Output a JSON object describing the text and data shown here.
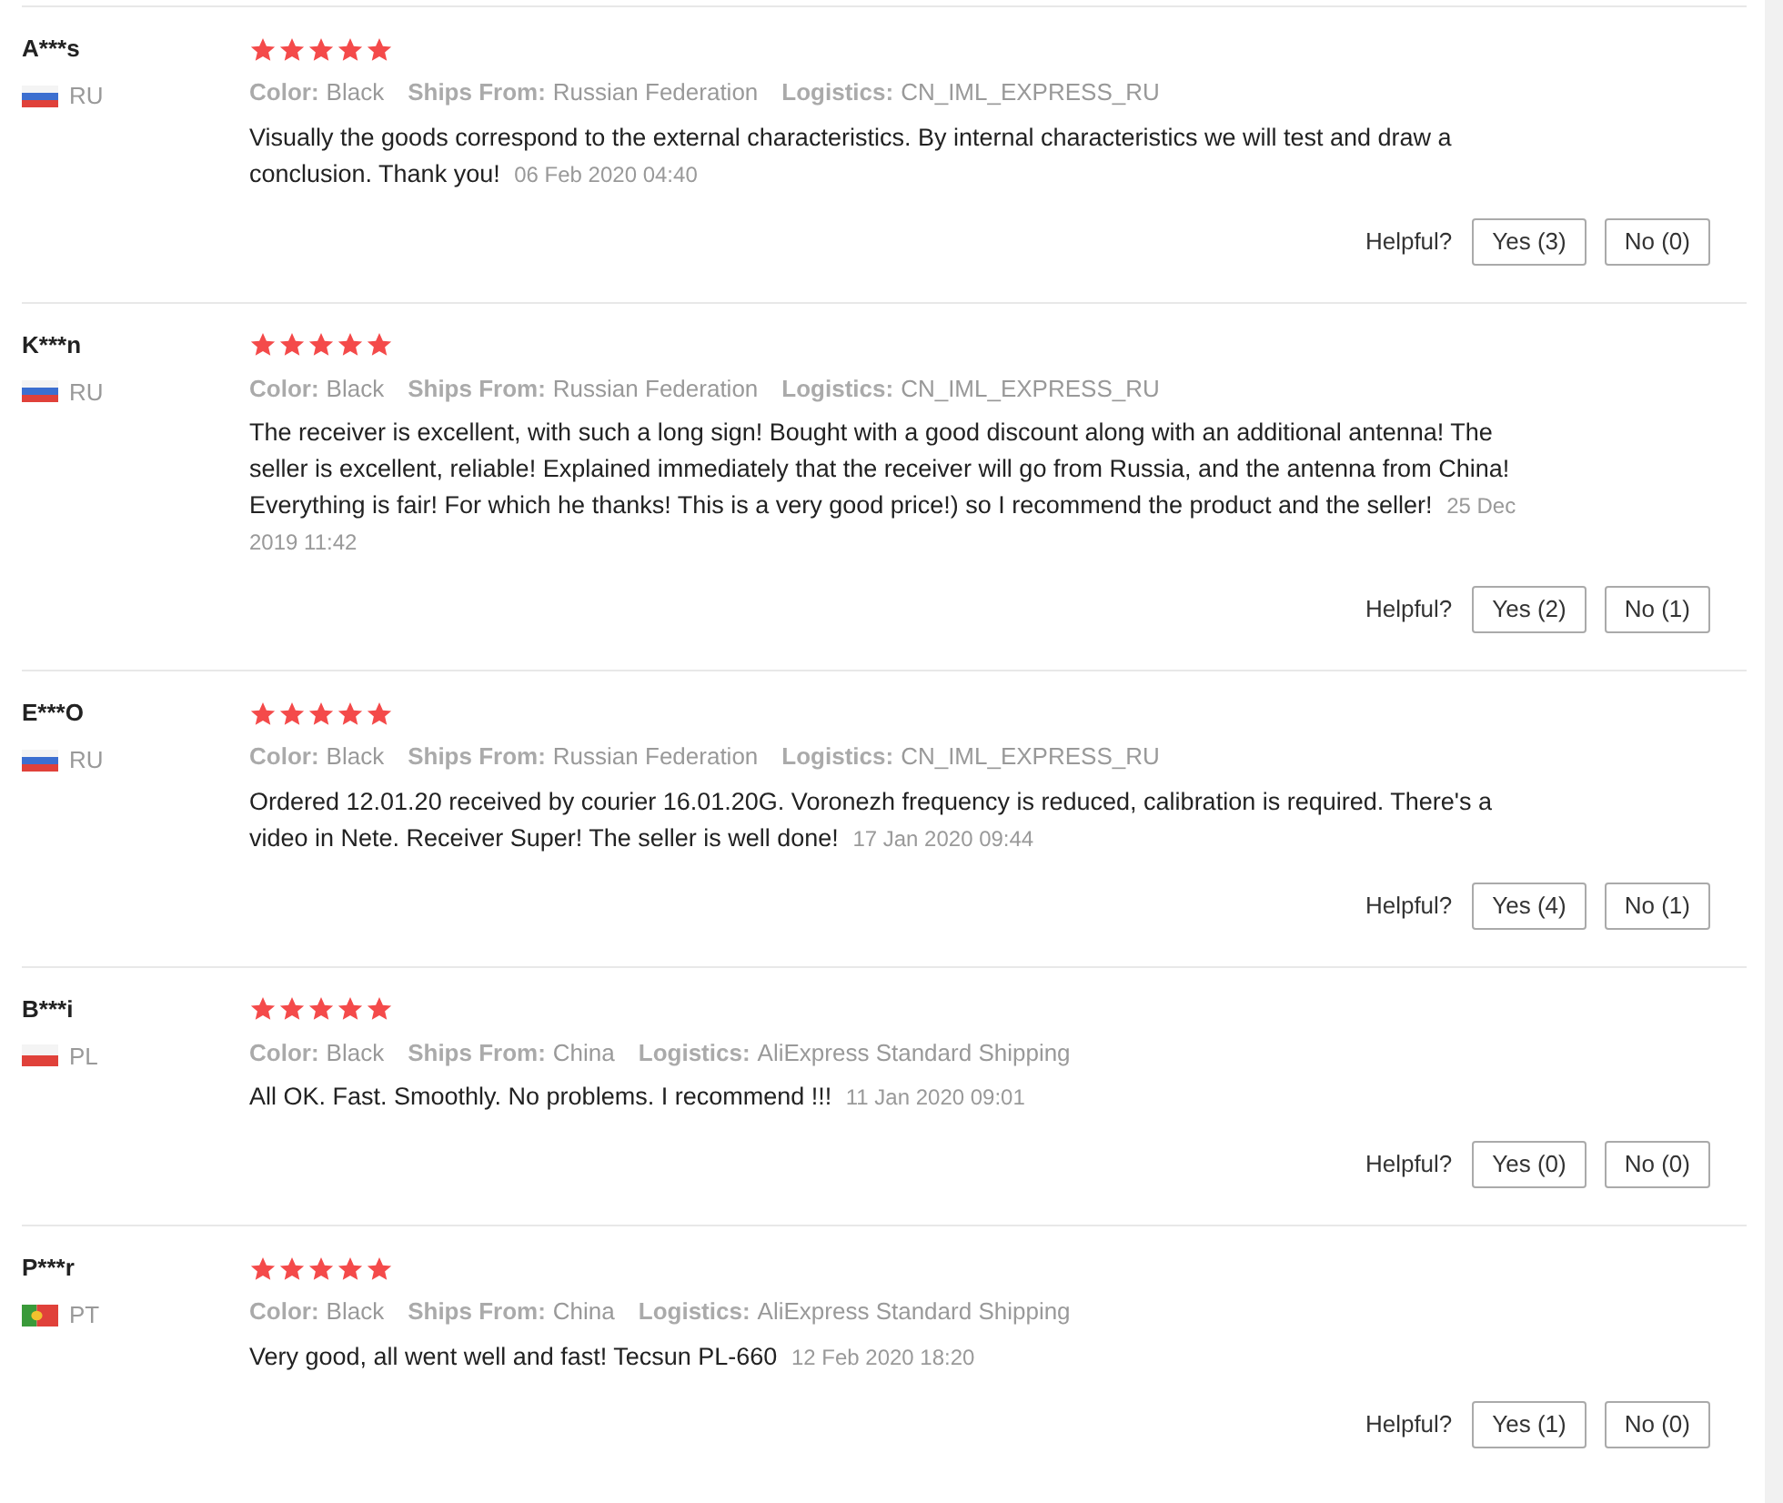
{
  "reviews": [
    {
      "name": "A***s",
      "kind": "ru",
      "country": "RU",
      "stars": 5,
      "color_label": "Color:",
      "color_value": "Black",
      "ships_label": "Ships From:",
      "ships": "Russian Federation",
      "logistics_label": "Logistics:",
      "logistics": "CN_IML_EXPRESS_RU",
      "text": "Visually the goods correspond to the external characteristics. By internal characteristics we will test and draw a conclusion. Thank you!",
      "date": "06 Feb 2020 04:40",
      "helpful": "Helpful?",
      "yes": "Yes (3)",
      "no": "No (0)"
    },
    {
      "name": "K***n",
      "kind": "ru",
      "country": "RU",
      "stars": 5,
      "color_label": "Color:",
      "color_value": "Black",
      "ships_label": "Ships From:",
      "ships": "Russian Federation",
      "logistics_label": "Logistics:",
      "logistics": "CN_IML_EXPRESS_RU",
      "text": "The receiver is excellent, with such a long sign! Bought with a good discount along with an additional antenna! The seller is excellent, reliable! Explained immediately that the receiver will go from Russia, and the antenna from China! Everything is fair! For which he thanks! This is a very good price!) so I recommend the product and the seller!",
      "date": "25 Dec 2019 11:42",
      "helpful": "Helpful?",
      "yes": "Yes (2)",
      "no": "No (1)"
    },
    {
      "name": "E***O",
      "kind": "ru",
      "country": "RU",
      "stars": 5,
      "color_label": "Color:",
      "color_value": "Black",
      "ships_label": "Ships From:",
      "ships": "Russian Federation",
      "logistics_label": "Logistics:",
      "logistics": "CN_IML_EXPRESS_RU",
      "text": "Ordered 12.01.20 received by courier 16.01.20G. Voronezh frequency is reduced, calibration is required. There's a video in Nete. Receiver Super! The seller is well done!",
      "date": "17 Jan 2020 09:44",
      "helpful": "Helpful?",
      "yes": "Yes (4)",
      "no": "No (1)"
    },
    {
      "name": "B***i",
      "kind": "pl",
      "country": "PL",
      "stars": 5,
      "color_label": "Color:",
      "color_value": "Black",
      "ships_label": "Ships From:",
      "ships": "China",
      "logistics_label": "Logistics:",
      "logistics": "AliExpress Standard Shipping",
      "text": "All OK. Fast. Smoothly. No problems. I recommend !!!",
      "date": "11 Jan 2020 09:01",
      "helpful": "Helpful?",
      "yes": "Yes (0)",
      "no": "No (0)"
    },
    {
      "name": "P***r",
      "kind": "pt",
      "country": "PT",
      "stars": 5,
      "color_label": "Color:",
      "color_value": "Black",
      "ships_label": "Ships From:",
      "ships": "China",
      "logistics_label": "Logistics:",
      "logistics": "AliExpress Standard Shipping",
      "text": "Very good, all went well and fast! Tecsun PL-660",
      "date": "12 Feb 2020 18:20",
      "helpful": "Helpful?",
      "yes": "Yes (1)",
      "no": "No (0)"
    }
  ]
}
